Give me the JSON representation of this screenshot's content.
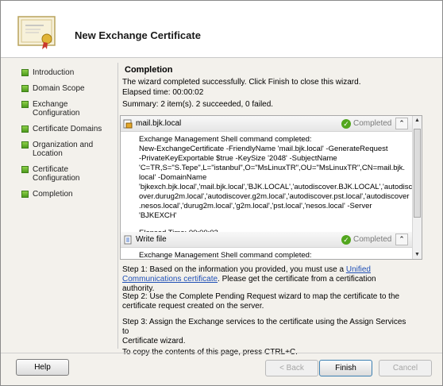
{
  "header": {
    "title": "New Exchange Certificate"
  },
  "steps": [
    {
      "label": "Introduction"
    },
    {
      "label": "Domain Scope"
    },
    {
      "label": "Exchange Configuration"
    },
    {
      "label": "Certificate Domains"
    },
    {
      "label": "Organization and Location"
    },
    {
      "label": "Certificate Configuration"
    },
    {
      "label": "Completion"
    }
  ],
  "main": {
    "title": "Completion",
    "message": "The wizard completed successfully. Click Finish to close this wizard.",
    "elapsed": "Elapsed time: 00:00:02",
    "summary": "Summary: 2 item(s). 2 succeeded, 0 failed."
  },
  "tasks": [
    {
      "name": "mail.bjk.local",
      "status": "Completed",
      "body": [
        "Exchange Management Shell command completed:",
        "New-ExchangeCertificate -FriendlyName 'mail.bjk.local' -GenerateRequest",
        "-PrivateKeyExportable $true -KeySize '2048' -SubjectName",
        "'C=TR,S=\"S.Tepe\",L=\"istanbul\",O=\"MsLinuxTR\",OU=\"MsLinuxTR\",CN=mail.bjk.",
        "local' -DomainName",
        "'bjkexch.bjk.local','mail.bjk.local','BJK.LOCAL','autodiscover.BJK.LOCAL','autodisc",
        "over.durug2m.local','autodiscover.g2m.local','autodiscover.pst.local','autodiscover",
        ".nesos.local','durug2m.local','g2m.local','pst.local','nesos.local' -Server 'BJKEXCH'"
      ],
      "elapsed": "Elapsed Time: 00:00:02"
    },
    {
      "name": "Write file",
      "status": "Completed",
      "body": [
        "Exchange Management Shell command completed:"
      ]
    }
  ],
  "instructions": {
    "step1_pre": "Step 1: Based on the information you provided, you must use a ",
    "step1_link_a": "Unified",
    "step1_link_b": "Communications certificate",
    "step1_post": ". Please get the certificate from a certification authority.",
    "step2": "Step 2: Use the Complete Pending Request wizard to map the certificate to the certificate request created on the server.",
    "step3_a": "Step 3: Assign the Exchange services to the certificate using the Assign Services to",
    "step3_b": "Certificate wizard.",
    "copy_hint": "To copy the contents of this page, press CTRL+C."
  },
  "buttons": {
    "help": "Help",
    "back": "< Back",
    "finish": "Finish",
    "cancel": "Cancel"
  },
  "colors": {
    "accent_green": "#52a61e",
    "link": "#1f4fb5"
  },
  "icons": [
    "certificate-icon",
    "green-step-bullet",
    "check-icon",
    "chevron-up-icon",
    "task-icon",
    "file-icon"
  ]
}
